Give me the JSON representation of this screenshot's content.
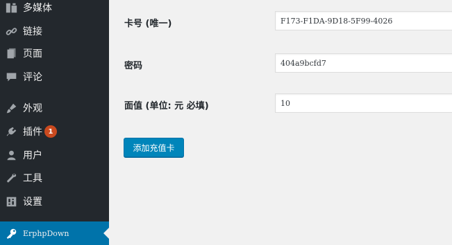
{
  "sidebar": {
    "items": [
      {
        "label": "多媒体",
        "icon": "media-icon"
      },
      {
        "label": "链接",
        "icon": "link-icon"
      },
      {
        "label": "页面",
        "icon": "page-icon"
      },
      {
        "label": "评论",
        "icon": "comment-icon"
      },
      {
        "label": "外观",
        "icon": "appearance-icon"
      },
      {
        "label": "插件",
        "icon": "plugin-icon",
        "badge": "1"
      },
      {
        "label": "用户",
        "icon": "user-icon"
      },
      {
        "label": "工具",
        "icon": "wrench-icon"
      },
      {
        "label": "设置",
        "icon": "settings-icon"
      },
      {
        "label": "ErphpDown",
        "icon": "key-icon",
        "active": true
      }
    ]
  },
  "form": {
    "card_number": {
      "label": "卡号 (唯一)",
      "value": "F173-F1DA-9D18-5F99-4026"
    },
    "password": {
      "label": "密码",
      "value": "404a9bcfd7"
    },
    "face_value": {
      "label": "面值 (单位: 元 必填)",
      "value": "10"
    },
    "submit_label": "添加充值卡"
  },
  "colors": {
    "sidebar_bg": "#23282d",
    "active_bg": "#0073aa",
    "button_bg": "#0085ba",
    "badge_bg": "#ca4a1f",
    "page_bg": "#f1f1f1"
  }
}
